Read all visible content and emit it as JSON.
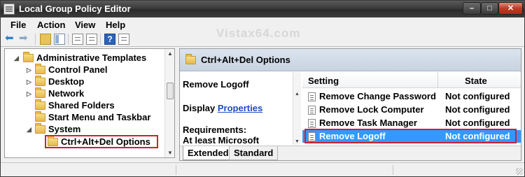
{
  "window": {
    "title": "Local Group Policy Editor",
    "controls": {
      "minimize": "–",
      "maximize": "□",
      "close": "✕"
    }
  },
  "menu": [
    "File",
    "Action",
    "View",
    "Help"
  ],
  "watermark": "Vistax64.com",
  "toolbar": {
    "icons": [
      "back-arrow-icon",
      "forward-arrow-icon",
      "up-folder-icon",
      "show-hide-tree-icon",
      "properties-icon",
      "export-list-icon",
      "help-icon",
      "filter-icon"
    ],
    "help_glyph": "?"
  },
  "tree": {
    "items": [
      {
        "label": "Administrative Templates",
        "expander": "◢"
      },
      {
        "label": "Control Panel",
        "expander": "▷"
      },
      {
        "label": "Desktop",
        "expander": "▷"
      },
      {
        "label": "Network",
        "expander": "▷"
      },
      {
        "label": "Shared Folders",
        "expander": ""
      },
      {
        "label": "Start Menu and Taskbar",
        "expander": ""
      },
      {
        "label": "System",
        "expander": "◢"
      },
      {
        "label": "Ctrl+Alt+Del Options",
        "expander": ""
      }
    ],
    "selected_index": 7
  },
  "pane": {
    "header": "Ctrl+Alt+Del Options",
    "description": {
      "title": "Remove Logoff",
      "display_prefix": "Display",
      "display_link": "Properties",
      "requirements_label": "Requirements:",
      "requirements_value": "At least Microsoft"
    },
    "columns": {
      "setting": "Setting",
      "state": "State"
    },
    "rows": [
      {
        "setting": "Remove Change Password",
        "state": "Not configured"
      },
      {
        "setting": "Remove Lock Computer",
        "state": "Not configured"
      },
      {
        "setting": "Remove Task Manager",
        "state": "Not configured"
      },
      {
        "setting": "Remove Logoff",
        "state": "Not configured"
      }
    ],
    "selected_row": 3,
    "tabs": [
      "Extended",
      "Standard"
    ],
    "active_tab": "Extended"
  },
  "colors": {
    "selection": "#3399ff",
    "highlight_outline": "#d01f2b",
    "link": "#1a4cc0"
  }
}
